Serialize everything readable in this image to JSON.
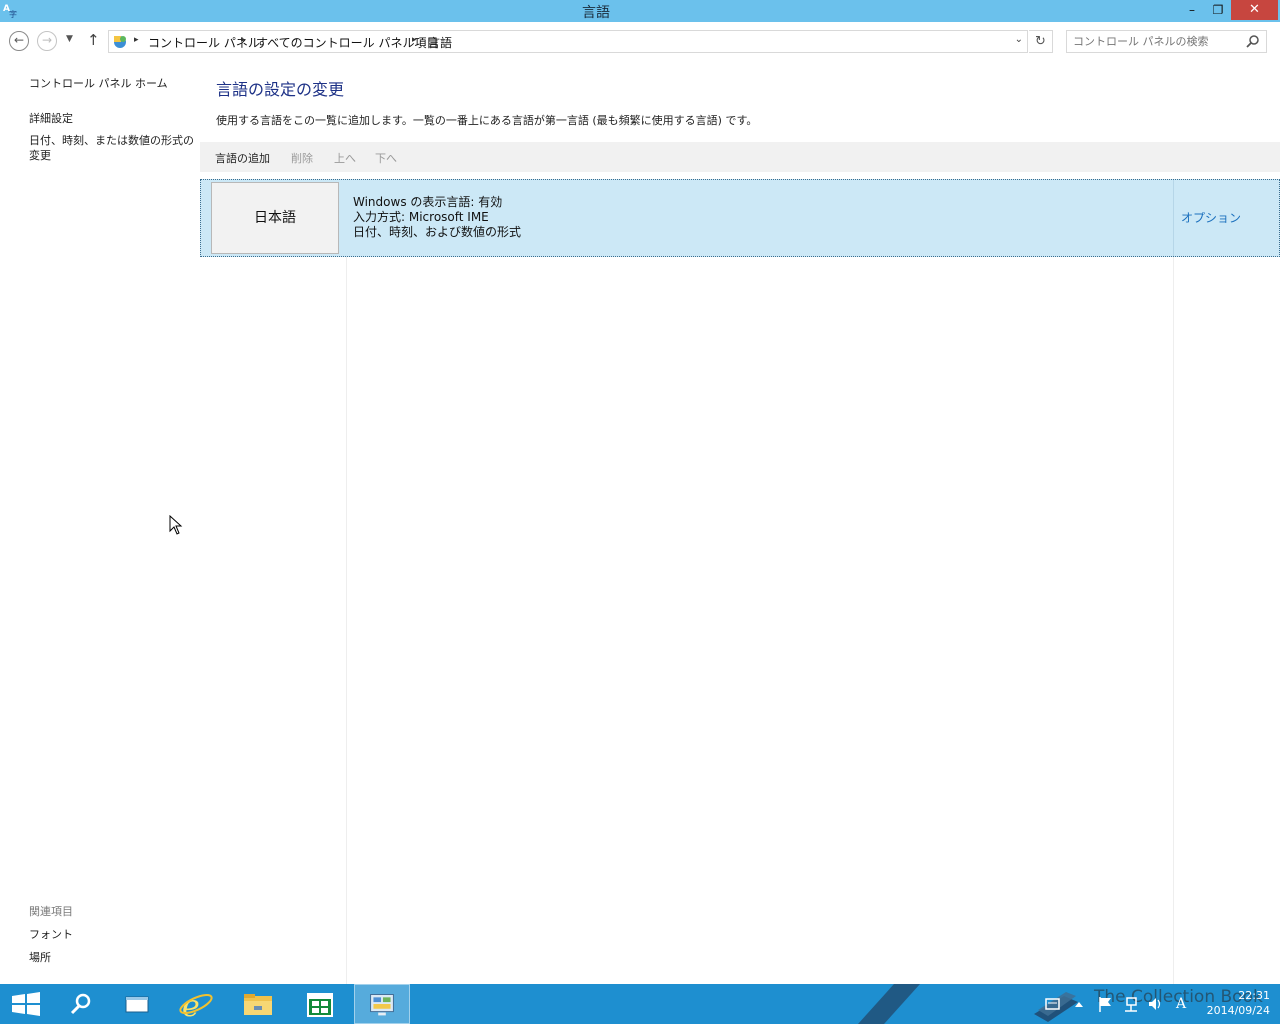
{
  "window": {
    "title": "言語",
    "minimize": "–",
    "restore": "❐",
    "close": "✕"
  },
  "addressbar": {
    "back": "←",
    "forward": "→",
    "up": "↑",
    "breadcrumbs": [
      "コントロール パネル",
      "すべてのコントロール パネル項目",
      "言語"
    ],
    "refresh": "↻",
    "search_placeholder": "コントロール パネルの検索"
  },
  "left_pane": {
    "home": "コントロール パネル ホーム",
    "advanced": "詳細設定",
    "datetime": "日付、時刻、または数値の形式の変更",
    "related_header": "関連項目",
    "fonts": "フォント",
    "location": "場所"
  },
  "main": {
    "heading": "言語の設定の変更",
    "description": "使用する言語をこの一覧に追加します。一覧の一番上にある言語が第一言語 (最も頻繁に使用する言語) です。",
    "toolbar": {
      "add": "言語の追加",
      "remove": "削除",
      "up": "上へ",
      "down": "下へ"
    },
    "languages": [
      {
        "name": "日本語",
        "line1": "Windows の表示言語: 有効",
        "line2": "入力方式: Microsoft IME",
        "line3": "日付、時刻、および数値の形式",
        "options": "オプション"
      }
    ]
  },
  "taskbar": {
    "time": "22:31",
    "date": "2014/09/24",
    "ime_indicator": "A",
    "watermark": "The Collection Book"
  },
  "colors": {
    "titlebar": "#6bc1ec",
    "close": "#c7463f",
    "selection": "#cce8f6",
    "link": "#1a6fbd",
    "heading": "#1e3287",
    "taskbar": "#1e8fd0"
  }
}
